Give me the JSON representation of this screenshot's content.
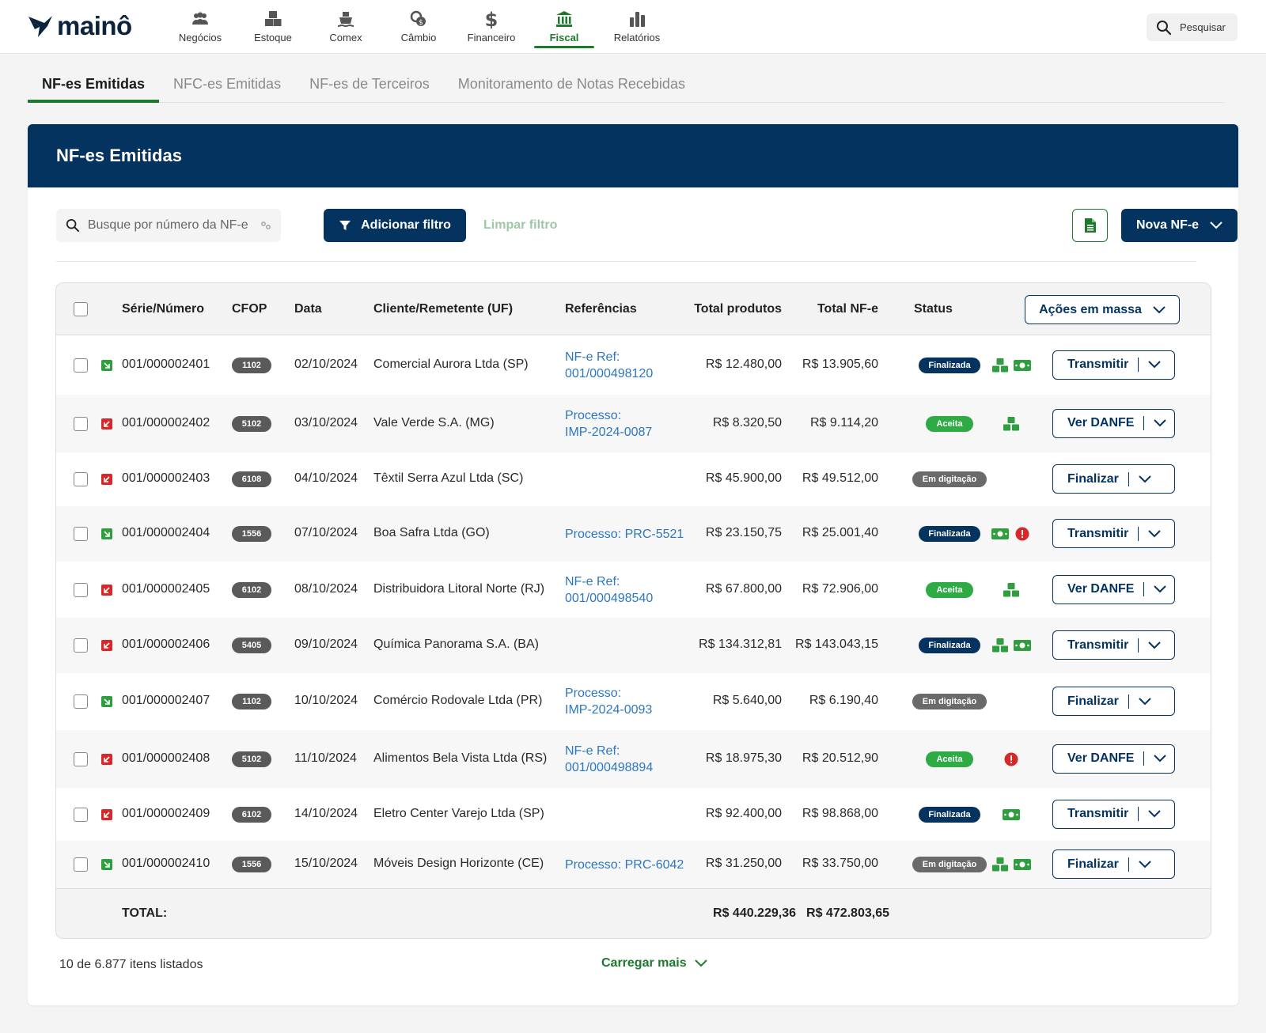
{
  "brand": {
    "name": "mainô"
  },
  "nav": {
    "items": [
      {
        "label": "Negócios",
        "icon": "users-icon"
      },
      {
        "label": "Estoque",
        "icon": "boxes-icon"
      },
      {
        "label": "Comex",
        "icon": "ship-icon"
      },
      {
        "label": "Câmbio",
        "icon": "coins-icon"
      },
      {
        "label": "Financeiro",
        "icon": "dollar-icon"
      },
      {
        "label": "Fiscal",
        "icon": "bank-icon",
        "active": true
      },
      {
        "label": "Relatórios",
        "icon": "bar-chart-icon"
      }
    ],
    "search_label": "Pesquisar"
  },
  "subtabs": [
    "NF-es Emitidas",
    "NFC-es Emitidas",
    "NF-es de Terceiros",
    "Monitoramento de Notas Recebidas"
  ],
  "card": {
    "title": "NF-es Emitidas",
    "search_placeholder": "Busque por número da NF-e",
    "add_filter": "Adicionar filtro",
    "clear_filter": "Limpar filtro",
    "new_nfe": "Nova NF-e"
  },
  "table": {
    "headers": {
      "serie": "Série/Número",
      "cfop": "CFOP",
      "data": "Data",
      "cliente": "Cliente/Remetente (UF)",
      "referencias": "Referências",
      "total_produtos": "Total produtos",
      "total_nfe": "Total NF-e",
      "status": "Status",
      "mass_actions": "Ações em massa"
    },
    "rows": [
      {
        "direction": "out",
        "serie": "001/000002401",
        "cfop": "1102",
        "data": "02/10/2024",
        "cliente": "Comercial Aurora Ltda (SP)",
        "ref1": "NF-e Ref:",
        "ref2": "001/000498120",
        "total_produtos": "R$ 12.480,00",
        "total_nfe": "R$ 13.905,60",
        "status": "Finalizada",
        "status_kind": "finalizada",
        "indicators": [
          "boxes-icon",
          "money-icon"
        ],
        "action": "Transmitir"
      },
      {
        "direction": "in",
        "serie": "001/000002402",
        "cfop": "5102",
        "data": "03/10/2024",
        "cliente": "Vale Verde S.A. (MG)",
        "ref1": "Processo:",
        "ref2": "IMP-2024-0087",
        "total_produtos": "R$ 8.320,50",
        "total_nfe": "R$ 9.114,20",
        "status": "Aceita",
        "status_kind": "aceita",
        "indicators": [
          "boxes-icon"
        ],
        "action": "Ver DANFE"
      },
      {
        "direction": "in",
        "serie": "001/000002403",
        "cfop": "6108",
        "data": "04/10/2024",
        "cliente": "Têxtil Serra Azul Ltda (SC)",
        "ref1": "",
        "ref2": "",
        "total_produtos": "R$ 45.900,00",
        "total_nfe": "R$ 49.512,00",
        "status": "Em digitação",
        "status_kind": "digitacao",
        "indicators": [],
        "action": "Finalizar"
      },
      {
        "direction": "out",
        "serie": "001/000002404",
        "cfop": "1556",
        "data": "07/10/2024",
        "cliente": "Boa Safra Ltda (GO)",
        "ref1": "Processo: PRC-5521",
        "ref2": "",
        "total_produtos": "R$ 23.150,75",
        "total_nfe": "R$ 25.001,40",
        "status": "Finalizada",
        "status_kind": "finalizada",
        "indicators": [
          "money-icon",
          "alert-icon"
        ],
        "action": "Transmitir"
      },
      {
        "direction": "in",
        "serie": "001/000002405",
        "cfop": "6102",
        "data": "08/10/2024",
        "cliente": "Distribuidora Litoral Norte (RJ)",
        "ref1": "NF-e Ref:",
        "ref2": "001/000498540",
        "total_produtos": "R$ 67.800,00",
        "total_nfe": "R$ 72.906,00",
        "status": "Aceita",
        "status_kind": "aceita",
        "indicators": [
          "boxes-icon"
        ],
        "action": "Ver DANFE"
      },
      {
        "direction": "in",
        "serie": "001/000002406",
        "cfop": "5405",
        "data": "09/10/2024",
        "cliente": "Química Panorama S.A. (BA)",
        "ref1": "",
        "ref2": "",
        "total_produtos": "R$ 134.312,81",
        "total_nfe": "R$ 143.043,15",
        "status": "Finalizada",
        "status_kind": "finalizada",
        "indicators": [
          "boxes-icon",
          "money-icon"
        ],
        "action": "Transmitir"
      },
      {
        "direction": "out",
        "serie": "001/000002407",
        "cfop": "1102",
        "data": "10/10/2024",
        "cliente": "Comércio Rodovale Ltda (PR)",
        "ref1": "Processo:",
        "ref2": "IMP-2024-0093",
        "total_produtos": "R$ 5.640,00",
        "total_nfe": "R$ 6.190,40",
        "status": "Em digitação",
        "status_kind": "digitacao",
        "indicators": [],
        "action": "Finalizar"
      },
      {
        "direction": "in",
        "serie": "001/000002408",
        "cfop": "5102",
        "data": "11/10/2024",
        "cliente": "Alimentos Bela Vista Ltda (RS)",
        "ref1": "NF-e Ref:",
        "ref2": "001/000498894",
        "total_produtos": "R$ 18.975,30",
        "total_nfe": "R$ 20.512,90",
        "status": "Aceita",
        "status_kind": "aceita",
        "indicators": [
          "alert-icon"
        ],
        "action": "Ver DANFE"
      },
      {
        "direction": "in",
        "serie": "001/000002409",
        "cfop": "6102",
        "data": "14/10/2024",
        "cliente": "Eletro Center Varejo Ltda (SP)",
        "ref1": "",
        "ref2": "",
        "total_produtos": "R$ 92.400,00",
        "total_nfe": "R$ 98.868,00",
        "status": "Finalizada",
        "status_kind": "finalizada",
        "indicators": [
          "money-icon"
        ],
        "action": "Transmitir"
      },
      {
        "direction": "out",
        "serie": "001/000002410",
        "cfop": "1556",
        "data": "15/10/2024",
        "cliente": "Móveis Design Horizonte (CE)",
        "ref1": "Processo: PRC-6042",
        "ref2": "",
        "total_produtos": "R$ 31.250,00",
        "total_nfe": "R$ 33.750,00",
        "status": "Em digitação",
        "status_kind": "digitacao",
        "indicators": [
          "boxes-icon",
          "money-icon"
        ],
        "action": "Finalizar"
      }
    ],
    "total_label": "TOTAL:",
    "total_produtos": "R$ 440.229,36",
    "total_nfe": "R$ 472.803,65"
  },
  "footer": {
    "count": "10 de 6.877 itens listados",
    "load_more": "Carregar mais"
  },
  "colors": {
    "primary": "#04335f",
    "accent": "#1b7a2c",
    "link": "#2c77c2",
    "danger": "#d62828"
  }
}
